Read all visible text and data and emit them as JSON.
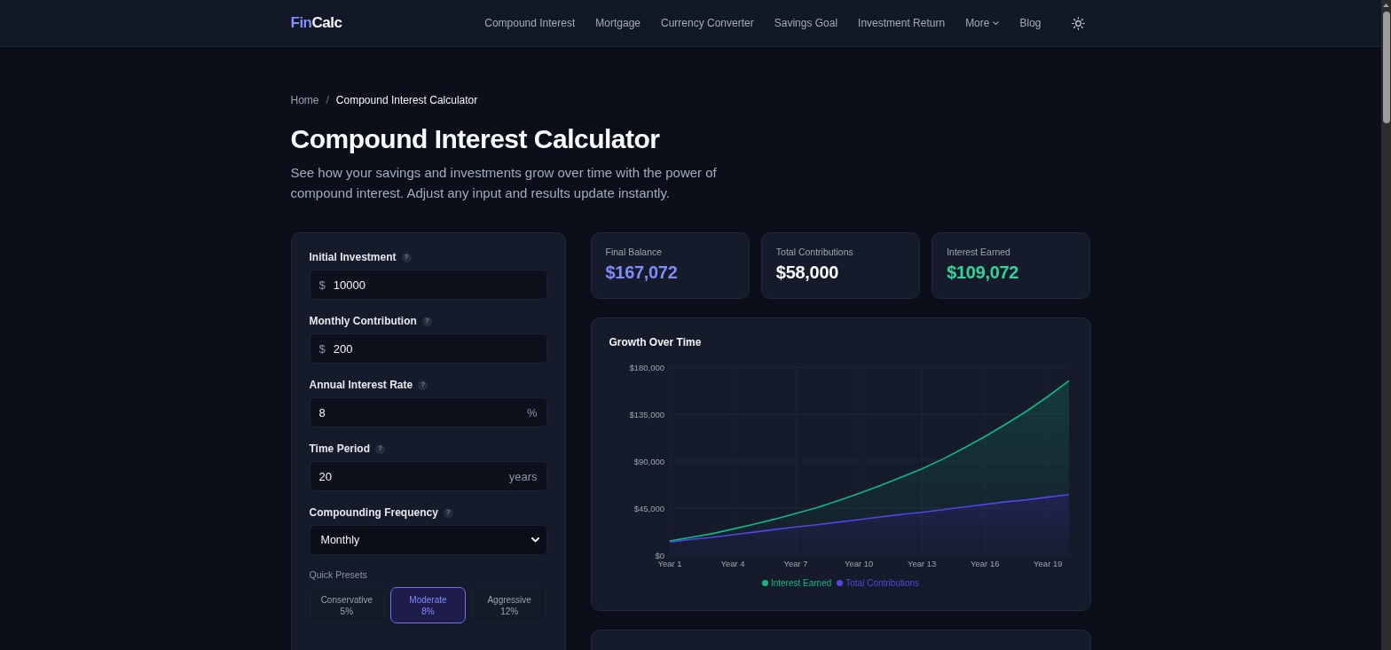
{
  "nav": {
    "logo": {
      "accent": "Fin",
      "text": "Calc"
    },
    "links": [
      {
        "label": "Compound Interest",
        "kind": "link"
      },
      {
        "label": "Mortgage",
        "kind": "link"
      },
      {
        "label": "Currency Converter",
        "kind": "link"
      },
      {
        "label": "Savings Goal",
        "kind": "link"
      },
      {
        "label": "Investment Return",
        "kind": "link"
      },
      {
        "label": "More",
        "kind": "dropdown"
      },
      {
        "label": "Blog",
        "kind": "link"
      }
    ]
  },
  "breadcrumb": {
    "separator": "/",
    "items": [
      {
        "label": "Home",
        "current": false
      },
      {
        "label": "Compound Interest Calculator",
        "current": true
      }
    ]
  },
  "title": "Compound Interest Calculator",
  "description": "See how your savings and investments grow over time with the power of compound interest. Adjust any input and results update instantly.",
  "inputs": {
    "fields": [
      {
        "label": "Initial Investment",
        "hint": "?",
        "kind": "number",
        "prefix": "$",
        "value": "10000"
      },
      {
        "label": "Monthly Contribution",
        "hint": "?",
        "kind": "number",
        "prefix": "$",
        "value": "200"
      },
      {
        "label": "Annual Interest Rate",
        "hint": "?",
        "kind": "number",
        "value": "8",
        "suffix": "%"
      },
      {
        "label": "Time Period",
        "hint": "?",
        "kind": "number",
        "value": "20",
        "suffix": "years"
      },
      {
        "label": "Compounding Frequency",
        "hint": "?",
        "kind": "select",
        "value": "Monthly"
      }
    ],
    "presets_label": "Quick Presets",
    "presets": [
      {
        "name": "Conservative",
        "rate": "5%",
        "selected": false
      },
      {
        "name": "Moderate",
        "rate": "8%",
        "selected": true
      },
      {
        "name": "Aggressive",
        "rate": "12%",
        "selected": false
      }
    ]
  },
  "stats": [
    {
      "label": "Final Balance",
      "value": "$167,072",
      "color": "#818cf8"
    },
    {
      "label": "Total Contributions",
      "value": "$58,000",
      "color": "#f9fafb"
    },
    {
      "label": "Interest Earned",
      "value": "$109,072",
      "color": "#34d399"
    }
  ],
  "growth_chart": {
    "chart_data": {
      "type": "area",
      "title": "Growth Over Time",
      "stacked": true,
      "categories": [
        "Year 1",
        null,
        null,
        "Year 4",
        null,
        null,
        "Year 7",
        null,
        null,
        "Year 10",
        null,
        null,
        "Year 13",
        null,
        null,
        "Year 16",
        null,
        null,
        "Year 19",
        null
      ],
      "ylim": [
        0,
        180000
      ],
      "yticks": [
        {
          "value": 0,
          "label": "$0"
        },
        {
          "value": 45000,
          "label": "$45,000"
        },
        {
          "value": 90000,
          "label": "$90,000"
        },
        {
          "value": 135000,
          "label": "$135,000"
        },
        {
          "value": 180000,
          "label": "$180,000"
        }
      ],
      "series": [
        {
          "name": "Interest Earned",
          "color": "#10b981",
          "values": [
            1000,
            2000,
            3500,
            5500,
            7500,
            10000,
            13000,
            16500,
            20500,
            25000,
            30000,
            35500,
            41500,
            48500,
            56500,
            65000,
            74500,
            85000,
            96500,
            109000
          ]
        },
        {
          "name": "Total Contributions",
          "color": "#4f46e5",
          "values": [
            12500,
            15000,
            17000,
            19500,
            22000,
            24500,
            27000,
            29000,
            31500,
            34000,
            36500,
            39000,
            41000,
            43500,
            46000,
            48500,
            51000,
            53000,
            55500,
            58000
          ]
        }
      ]
    }
  }
}
